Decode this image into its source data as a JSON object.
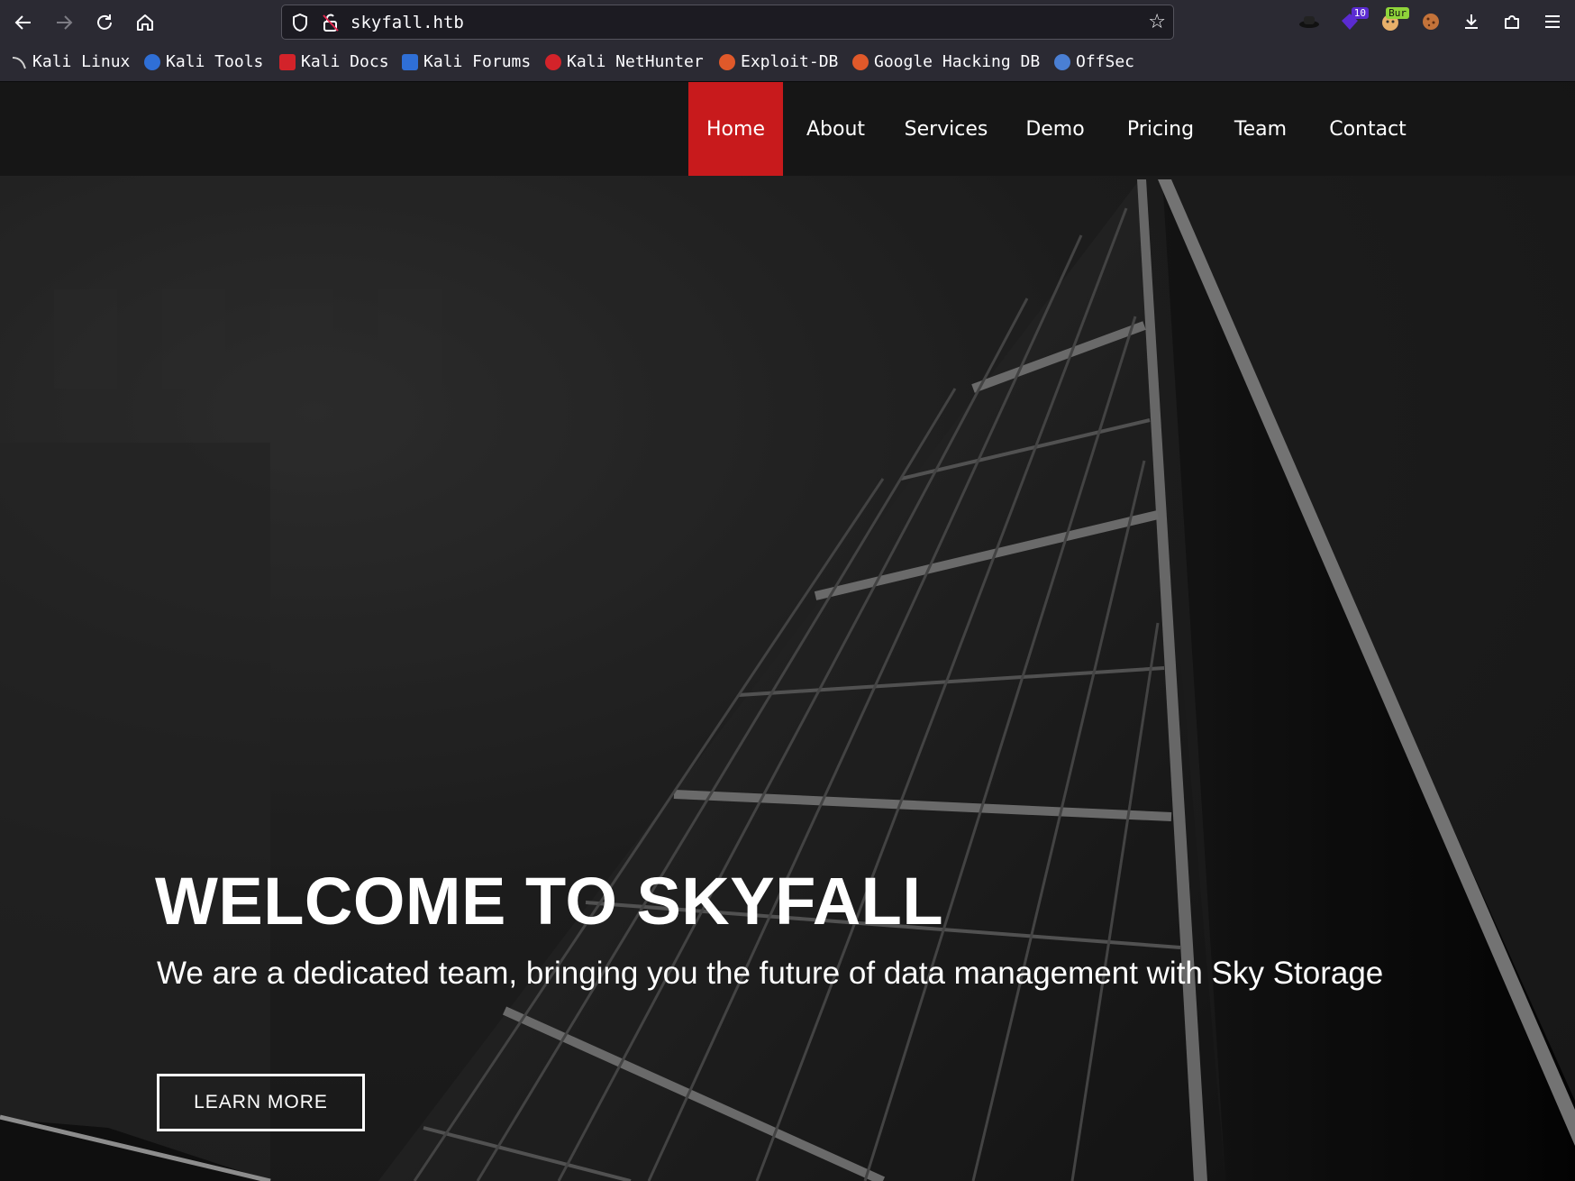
{
  "browser": {
    "url": "skyfall.htb",
    "badges": {
      "extension_count": "10",
      "burp": "Bur"
    },
    "bookmarks": [
      {
        "label": "Kali Linux"
      },
      {
        "label": "Kali Tools"
      },
      {
        "label": "Kali Docs"
      },
      {
        "label": "Kali Forums"
      },
      {
        "label": "Kali NetHunter"
      },
      {
        "label": "Exploit-DB"
      },
      {
        "label": "Google Hacking DB"
      },
      {
        "label": "OffSec"
      }
    ]
  },
  "site": {
    "nav": [
      {
        "label": "Home",
        "active": true
      },
      {
        "label": "About"
      },
      {
        "label": "Services"
      },
      {
        "label": "Demo"
      },
      {
        "label": "Pricing"
      },
      {
        "label": "Team"
      },
      {
        "label": "Contact"
      }
    ],
    "hero": {
      "title": "WELCOME TO SKYFALL",
      "subtitle": "We are a dedicated team, bringing you the future of data management with Sky Storage",
      "cta": "LEARN MORE"
    }
  },
  "colors": {
    "accent": "#c81a1c",
    "chrome": "#2b2a33",
    "urlbar": "#1c1b22"
  }
}
